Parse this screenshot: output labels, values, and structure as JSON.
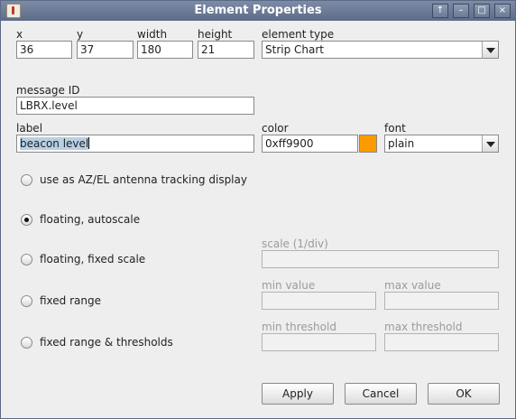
{
  "window": {
    "title": "Element Properties"
  },
  "titlebar_buttons": {
    "up": "↑",
    "min": "–",
    "max": "□",
    "close": "×"
  },
  "position": {
    "x_label": "x",
    "x_value": "36",
    "y_label": "y",
    "y_value": "37",
    "width_label": "width",
    "width_value": "180",
    "height_label": "height",
    "height_value": "21"
  },
  "element_type": {
    "label": "element type",
    "value": "Strip Chart"
  },
  "message_id": {
    "label": "message ID",
    "value": "LBRX.level"
  },
  "label_field": {
    "label": "label",
    "value": "beacon level"
  },
  "color": {
    "label": "color",
    "value": "0xff9900",
    "swatch": "#ff9900"
  },
  "font": {
    "label": "font",
    "value": "plain"
  },
  "options": [
    {
      "label": "use as AZ/EL antenna tracking display",
      "selected": false
    },
    {
      "label": "floating, autoscale",
      "selected": true
    },
    {
      "label": "floating, fixed scale",
      "selected": false
    },
    {
      "label": "fixed range",
      "selected": false
    },
    {
      "label": "fixed range & thresholds",
      "selected": false
    }
  ],
  "scale": {
    "label": "scale (1/div)",
    "value": ""
  },
  "range": {
    "min_label": "min value",
    "max_label": "max value"
  },
  "thresholds": {
    "min_label": "min threshold",
    "max_label": "max threshold"
  },
  "buttons": {
    "apply": "Apply",
    "cancel": "Cancel",
    "ok": "OK"
  }
}
